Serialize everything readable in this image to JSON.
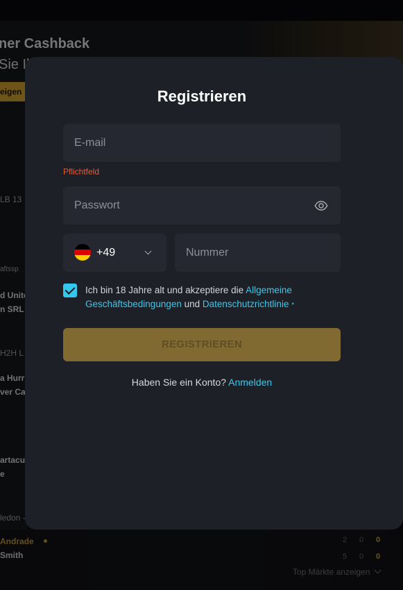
{
  "background": {
    "banner_title": "ner Cashback",
    "banner_subtitle": "Sie Ih",
    "banner_button": "eigen",
    "fragments": [
      "LB  13",
      "aftssp",
      "d Unite",
      "n SRL",
      "H2H L",
      "a Hurric",
      "ver Ca",
      "artacus",
      "e",
      "ledon -"
    ],
    "bottom": {
      "row1_name": "Andrade",
      "row2_name": "Smith",
      "row1_scores": [
        "2",
        "0",
        "0"
      ],
      "row2_scores": [
        "5",
        "0",
        "0"
      ],
      "more_label": "Top Märkte anzeigen"
    }
  },
  "modal": {
    "title": "Registrieren",
    "email_placeholder": "E-mail",
    "email_error": "Pflichtfeld",
    "password_placeholder": "Passwort",
    "country_code": "+49",
    "number_placeholder": "Nummer",
    "consent": {
      "text_1": "Ich bin 18 Jahre alt und akzeptiere die ",
      "terms_link": "Allgemeine Geschäftsbedingungen",
      "text_2": " und ",
      "privacy_link": "Datenschutzrichtlinie",
      "required_mark": "*",
      "checked": true
    },
    "submit_label": "REGISTRIEREN",
    "login_prompt": "Haben Sie ein Konto?",
    "login_link": "Anmelden"
  },
  "colors": {
    "accent": "#3ec7ea",
    "error": "#ee5b35",
    "button": "#806a31",
    "modal_bg": "#1e2027",
    "field_bg": "#262831"
  },
  "icons": {
    "password_toggle": "eye-icon",
    "country_flag": "germany-flag-icon",
    "dropdown": "chevron-down-icon",
    "checkbox": "checkmark-icon"
  }
}
